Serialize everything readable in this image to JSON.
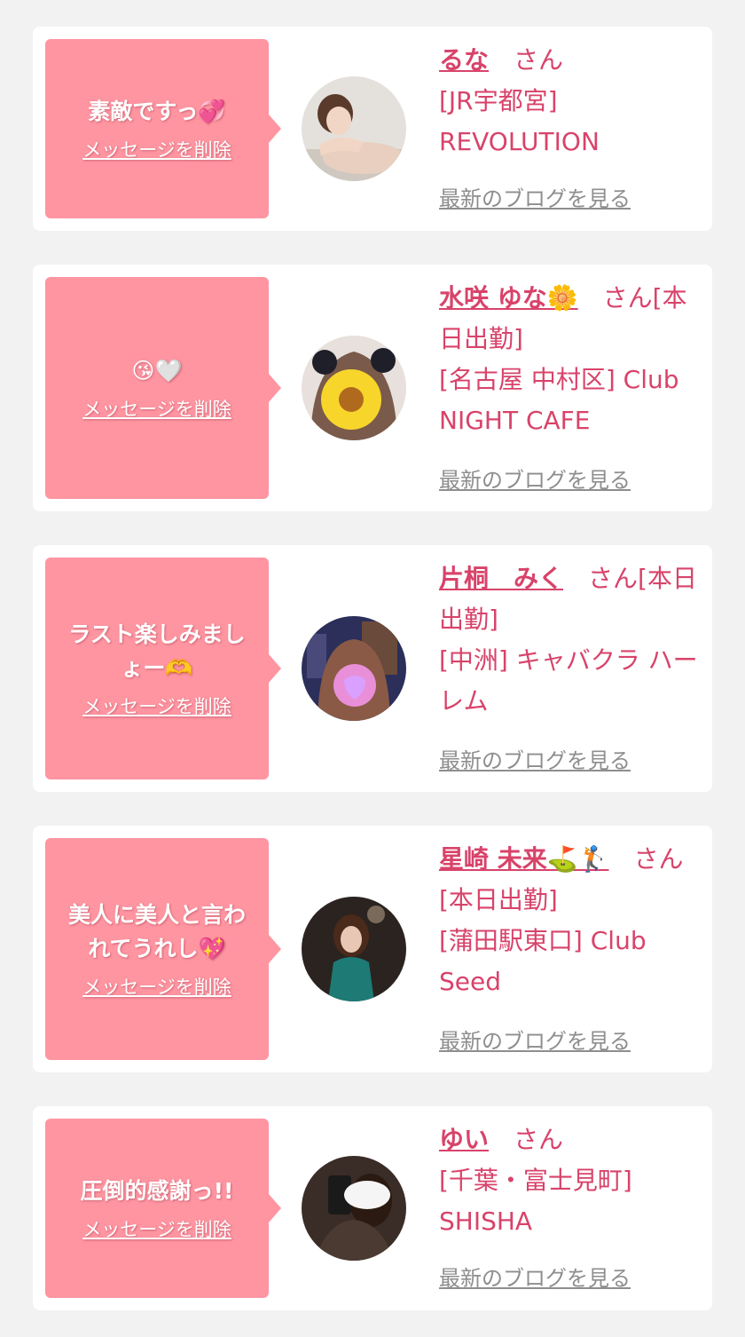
{
  "messages": [
    {
      "text": "素敵ですっ💞",
      "delete_label": "メッセージを削除",
      "name": "るな",
      "honorific": "さん",
      "shop": "[JR宇都宮] REVOLUTION",
      "blog_label": "最新のブログを見る"
    },
    {
      "text": "😘🤍",
      "delete_label": "メッセージを削除",
      "name": "水咲 ゆな🌼",
      "honorific": "さん[本日出勤]",
      "shop": "[名古屋 中村区] Club NIGHT CAFE",
      "blog_label": "最新のブログを見る"
    },
    {
      "text": "ラスト楽しみましょー🫶",
      "delete_label": "メッセージを削除",
      "name": "片桐　みく",
      "honorific": "さん[本日出勤]",
      "shop": "[中洲] キャバクラ ハーレム",
      "blog_label": "最新のブログを見る"
    },
    {
      "text": "美人に美人と言われてうれし💖",
      "delete_label": "メッセージを削除",
      "name": "星崎 未来⛳🏌",
      "honorific": "さん[本日出勤]",
      "shop": "[蒲田駅東口] Club Seed",
      "blog_label": "最新のブログを見る"
    },
    {
      "text": "圧倒的感謝っ!!",
      "delete_label": "メッセージを削除",
      "name": "ゆい",
      "honorific": "さん",
      "shop": "[千葉・富士見町] SHISHA",
      "blog_label": "最新のブログを見る"
    }
  ],
  "colors": {
    "page_background": "#f2f2f2",
    "card_background": "#ffffff",
    "bubble": "#fe95a1",
    "accent_text": "#d8436a",
    "blog_link": "#8e8e8e"
  }
}
